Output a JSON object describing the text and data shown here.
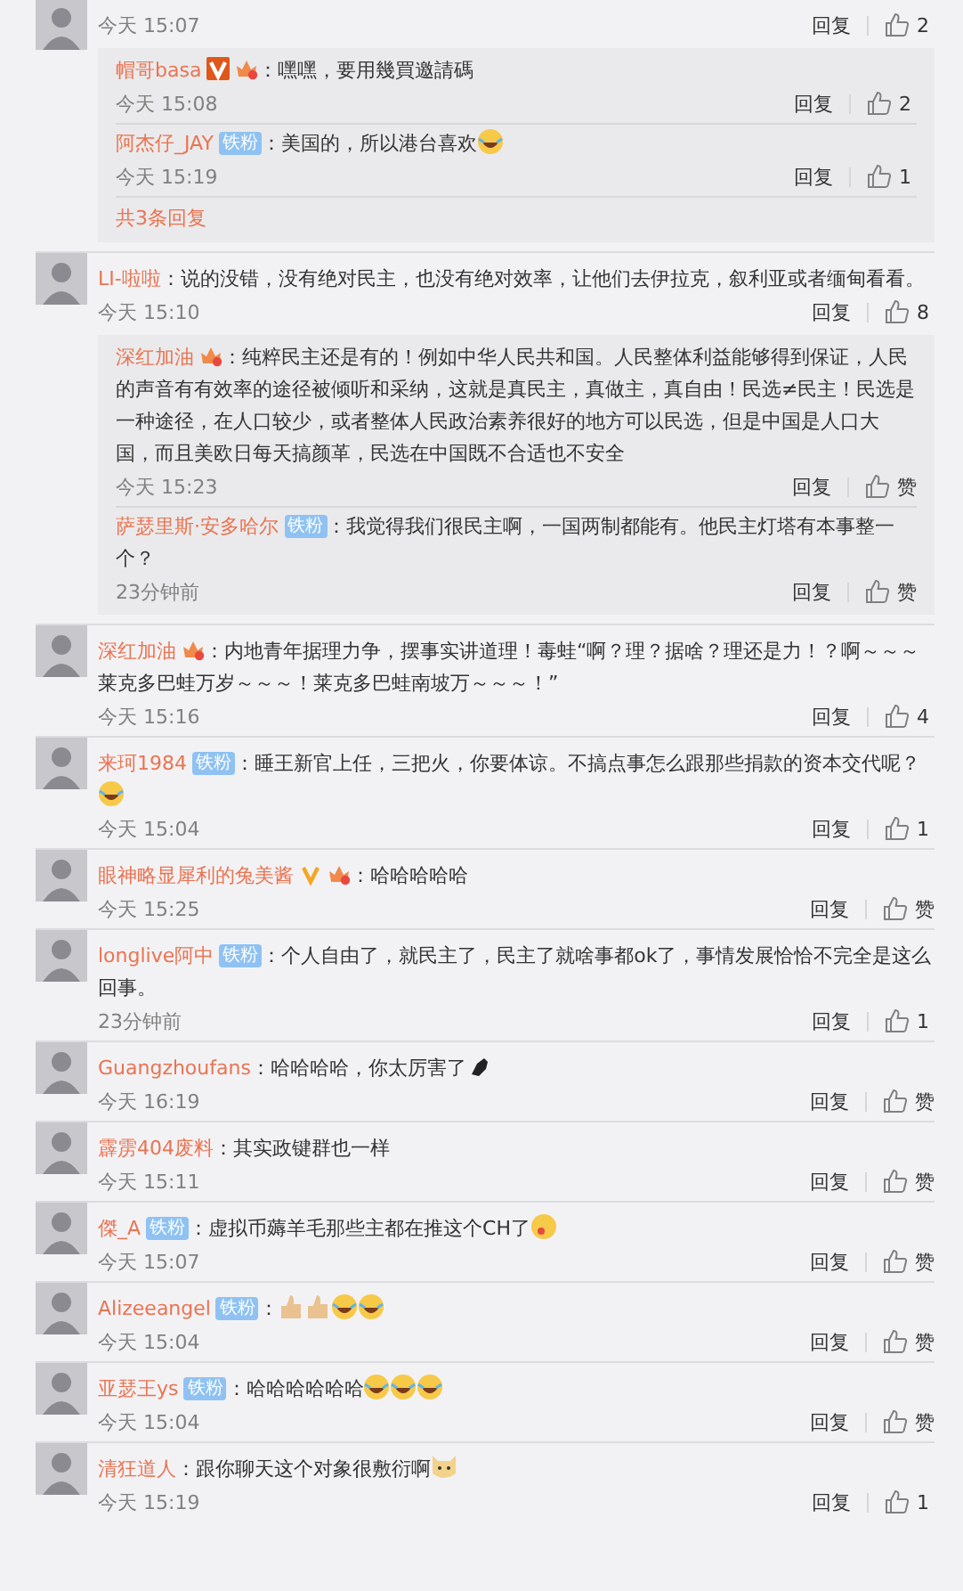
{
  "comments": [
    {
      "time": "今天 15:07",
      "reply": "回复",
      "like": "2",
      "replies": [
        {
          "name": "帽哥basa",
          "badges": [
            {
              "kind": "vip"
            },
            {
              "kind": "crown"
            }
          ],
          "text": "：嘿嘿，要用幾買邀請碼",
          "time": "今天 15:08",
          "reply": "回复",
          "like": "2"
        },
        {
          "name": "阿杰仔_JAY",
          "badges": [
            {
              "kind": "fan",
              "label": "铁粉"
            }
          ],
          "text": "：美国的，所以港台喜欢",
          "emojis": [
            {
              "kind": "laugh"
            }
          ],
          "time": "今天 15:19",
          "reply": "回复",
          "like": "1"
        }
      ],
      "more": "共3条回复"
    },
    {
      "name": "LI-啦啦",
      "text": "：说的没错，没有绝对民主，也没有绝对效率，让他们去伊拉克，叙利亚或者缅甸看看。",
      "time": "今天 15:10",
      "reply": "回复",
      "like": "8",
      "replies": [
        {
          "name": "深红加油",
          "badges": [
            {
              "kind": "crown"
            }
          ],
          "text": "：纯粹民主还是有的！例如中华人民共和国。人民整体利益能够得到保证，人民的声音有有效率的途径被倾听和采纳，这就是真民主，真做主，真自由！民选≠民主！民选是一种途径，在人口较少，或者整体人民政治素养很好的地方可以民选，但是中国是人口大国，而且美欧日每天搞颜革，民选在中国既不合适也不安全",
          "time": "今天 15:23",
          "reply": "回复",
          "like": "赞"
        },
        {
          "name": "萨瑟里斯·安多哈尔",
          "badges": [
            {
              "kind": "fan",
              "label": "铁粉"
            }
          ],
          "text": "：我觉得我们很民主啊，一国两制都能有。他民主灯塔有本事整一个？",
          "time": "23分钟前",
          "reply": "回复",
          "like": "赞"
        }
      ]
    },
    {
      "name": "深红加油",
      "badges": [
        {
          "kind": "crown"
        }
      ],
      "text": "：内地青年据理力争，摆事实讲道理！毒蛙“啊？理？据啥？理还是力！？啊～～～莱克多巴蛙万岁～～～！莱克多巴蛙南坡万～～～！”",
      "time": "今天 15:16",
      "reply": "回复",
      "like": "4"
    },
    {
      "name": "来珂1984",
      "badges": [
        {
          "kind": "fan",
          "label": "铁粉"
        }
      ],
      "text": "：睡王新官上任，三把火，你要体谅。不搞点事怎么跟那些捐款的资本交代呢？",
      "emojis": [
        {
          "kind": "laugh"
        }
      ],
      "time": "今天 15:04",
      "reply": "回复",
      "like": "1"
    },
    {
      "name": "眼神略显犀利的兔美酱",
      "badges": [
        {
          "kind": "vip-gold"
        },
        {
          "kind": "crown"
        }
      ],
      "text": "：哈哈哈哈哈",
      "time": "今天 15:25",
      "reply": "回复",
      "like": "赞"
    },
    {
      "name": "longlive阿中",
      "badges": [
        {
          "kind": "fan",
          "label": "铁粉"
        }
      ],
      "text": "：个人自由了，就民主了，民主了就啥事都ok了，事情发展恰恰不完全是这么回事。",
      "time": "23分钟前",
      "reply": "回复",
      "like": "1"
    },
    {
      "name": "Guangzhoufans",
      "text": "：哈哈哈哈，你太厉害了",
      "emojis": [
        {
          "kind": "point"
        }
      ],
      "time": "今天 16:19",
      "reply": "回复",
      "like": "赞"
    },
    {
      "name": "霹雳404废料",
      "text": "：其实政键群也一样",
      "time": "今天 15:11",
      "reply": "回复",
      "like": "赞"
    },
    {
      "name": "傑_A",
      "badges": [
        {
          "kind": "fan",
          "label": "铁粉"
        }
      ],
      "text": "：虚拟币薅羊毛那些主都在推这个CH了",
      "emojis": [
        {
          "kind": "drool"
        }
      ],
      "time": "今天 15:07",
      "reply": "回复",
      "like": "赞"
    },
    {
      "name": "Alizeeangel",
      "badges": [
        {
          "kind": "fan",
          "label": "铁粉"
        }
      ],
      "text": "：",
      "emojis": [
        {
          "kind": "thumb"
        },
        {
          "kind": "thumb"
        },
        {
          "kind": "laugh"
        },
        {
          "kind": "laugh"
        }
      ],
      "time": "今天 15:04",
      "reply": "回复",
      "like": "赞"
    },
    {
      "name": "亚瑟王ys",
      "badges": [
        {
          "kind": "fan",
          "label": "铁粉"
        }
      ],
      "text": "：哈哈哈哈哈哈",
      "emojis": [
        {
          "kind": "laugh"
        },
        {
          "kind": "laugh"
        },
        {
          "kind": "laugh"
        }
      ],
      "time": "今天 15:04",
      "reply": "回复",
      "like": "赞"
    },
    {
      "name": "清狂道人",
      "text": "：跟你聊天这个对象很敷衍啊",
      "emojis": [
        {
          "kind": "dog"
        }
      ],
      "time": "今天 15:19",
      "reply": "回复",
      "like": "1"
    }
  ]
}
